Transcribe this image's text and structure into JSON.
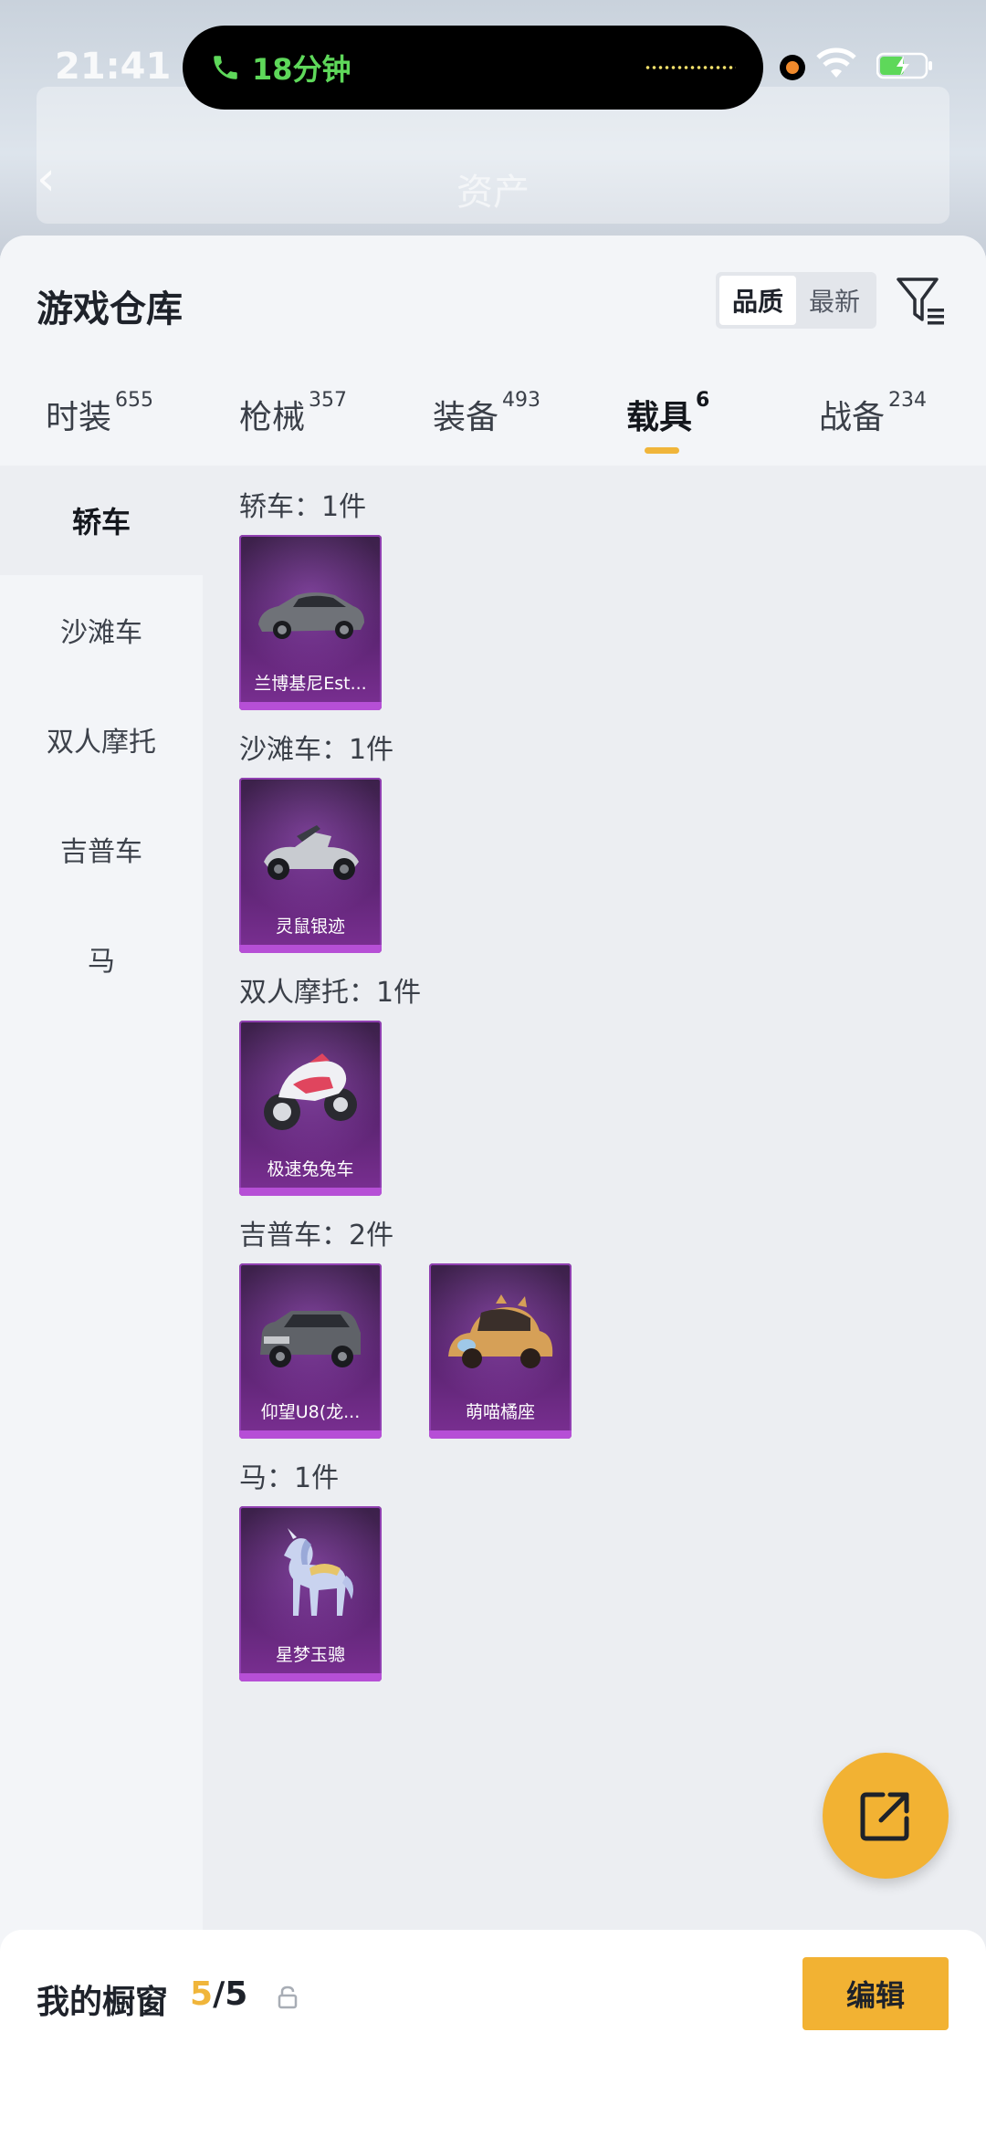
{
  "status_bar": {
    "time": "21:41",
    "call_text": "18分钟",
    "icons": [
      "phone-icon",
      "recording-dot-icon",
      "wifi-icon",
      "battery-charging-icon"
    ]
  },
  "background_app": {
    "title": "资产"
  },
  "sheet": {
    "title": "游戏仓库",
    "sort_options": [
      {
        "label": "品质",
        "active": true
      },
      {
        "label": "最新",
        "active": false
      }
    ],
    "filter_icon": "filter-icon"
  },
  "tabs": [
    {
      "label": "时装",
      "count": "655",
      "active": false
    },
    {
      "label": "枪械",
      "count": "357",
      "active": false
    },
    {
      "label": "装备",
      "count": "493",
      "active": false
    },
    {
      "label": "载具",
      "count": "6",
      "active": true
    },
    {
      "label": "战备",
      "count": "234",
      "active": false
    }
  ],
  "sidebar": {
    "items": [
      {
        "label": "轿车",
        "active": true
      },
      {
        "label": "沙滩车",
        "active": false
      },
      {
        "label": "双人摩托",
        "active": false
      },
      {
        "label": "吉普车",
        "active": false
      },
      {
        "label": "马",
        "active": false
      }
    ]
  },
  "groups": [
    {
      "label": "轿车：1件",
      "items": [
        {
          "name": "兰博基尼Est...",
          "icon": "sports-car-icon"
        }
      ]
    },
    {
      "label": "沙滩车：1件",
      "items": [
        {
          "name": "灵鼠银迹",
          "icon": "buggy-icon"
        }
      ]
    },
    {
      "label": "双人摩托：1件",
      "items": [
        {
          "name": "极速兔兔车",
          "icon": "motorcycle-icon"
        }
      ]
    },
    {
      "label": "吉普车：2件",
      "items": [
        {
          "name": "仰望U8(龙...",
          "icon": "suv-icon"
        },
        {
          "name": "萌喵橘座",
          "icon": "cat-car-icon"
        }
      ]
    },
    {
      "label": "马：1件",
      "items": [
        {
          "name": "星梦玉骢",
          "icon": "horse-icon"
        }
      ]
    }
  ],
  "fab": {
    "icon": "share-external-icon"
  },
  "showcase": {
    "label": "我的橱窗",
    "current": "5",
    "total": "/5",
    "lock_icon": "lock-icon",
    "edit_label": "编辑"
  }
}
